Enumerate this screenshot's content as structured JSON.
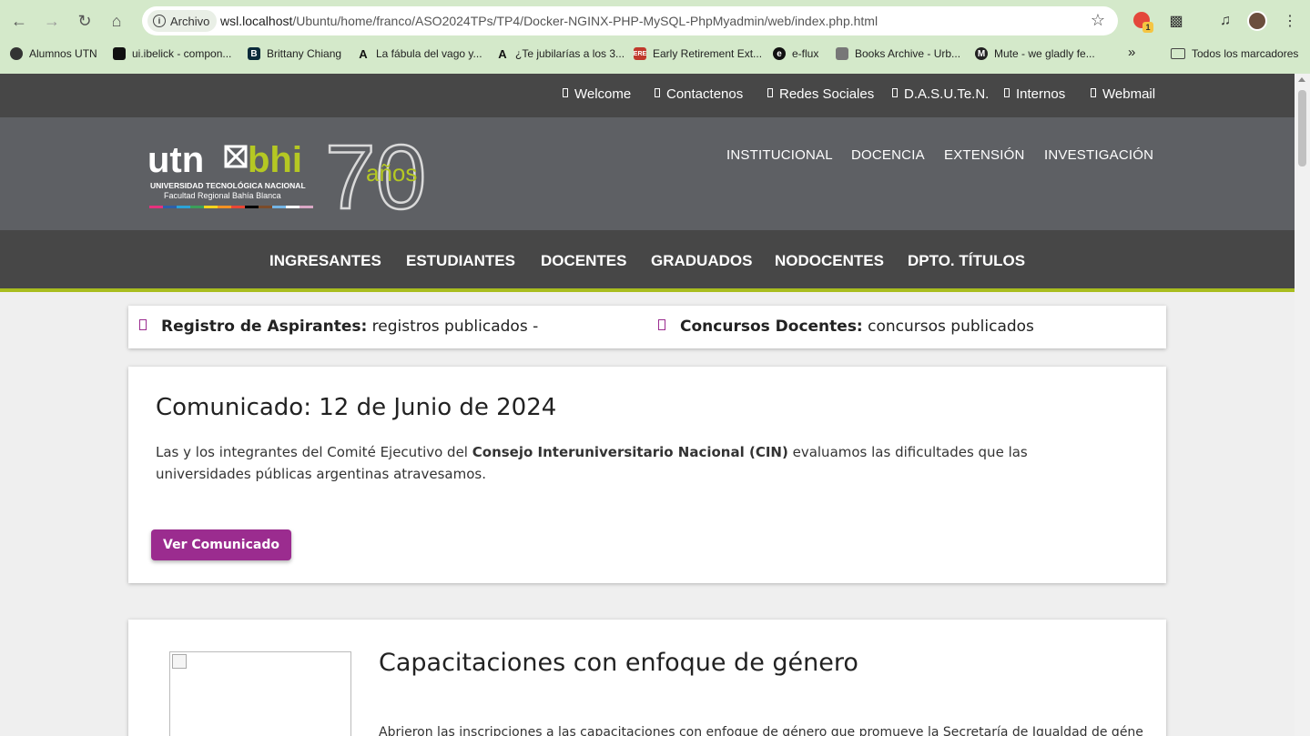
{
  "browser": {
    "address_chip": "Archivo",
    "url_host": "wsl.localhost",
    "url_path": "/Ubuntu/home/franco/ASO2024TPs/TP4/Docker-NGINX-PHP-MySQL-PhpMyadmin/web/index.php.html",
    "extension_badge": "1",
    "bookmarks": [
      "Alumnos UTN",
      "ui.ibelick - compon...",
      "Brittany Chiang",
      "La fábula del vago y...",
      "¿Te jubilarías a los 3...",
      "Early Retirement Ext...",
      "e-flux",
      "Books Archive - Urb...",
      "Mute - we gladly fe..."
    ],
    "bookmarks_overflow": "»",
    "all_bookmarks": "Todos los marcadores"
  },
  "topbar": {
    "links": [
      "Welcome",
      "Contactenos",
      "Redes Sociales",
      "D.A.S.U.Te.N.",
      "Internos",
      "Webmail"
    ]
  },
  "header": {
    "logo": {
      "utn": "utn",
      "bhi": "bhi",
      "line1": "UNIVERSIDAD TECNOLÓGICA NACIONAL",
      "line2": "Facultad Regional Bahía Blanca",
      "anniversary": "70",
      "anniversary_word": "años"
    },
    "main_links": [
      "INSTITUCIONAL",
      "DOCENCIA",
      "EXTENSIÓN",
      "INVESTIGACIÓN"
    ]
  },
  "subnav": {
    "links": [
      "INGRESANTES",
      "ESTUDIANTES",
      "DOCENTES",
      "GRADUADOS",
      "NODOCENTES",
      "DPTO. TÍTULOS"
    ]
  },
  "ticker": {
    "item1_bold": "Registro de Aspirantes:",
    "item1_text": " registros publicados -",
    "item2_bold": "Concursos Docentes:",
    "item2_text": " concursos publicados"
  },
  "news1": {
    "title": "Comunicado: 12 de Junio de 2024",
    "text_before": "Las y los integrantes del Comité Ejecutivo del ",
    "text_bold": "Consejo Interuniversitario Nacional (CIN)",
    "text_after": " evaluamos las dificultades que las universidades públicas argentinas atravesamos.",
    "button": "Ver Comunicado"
  },
  "news2": {
    "title": "Capacitaciones con enfoque de género",
    "text": "Abrieron las inscripciones a las capacitaciones con enfoque de género que promueve la Secretaría de Igualdad de género y"
  },
  "colors": {
    "accent_purple": "#9b2c8f",
    "accent_green": "#a9bd1f",
    "dark_bar": "#474747",
    "header_gray": "#5e6064"
  }
}
